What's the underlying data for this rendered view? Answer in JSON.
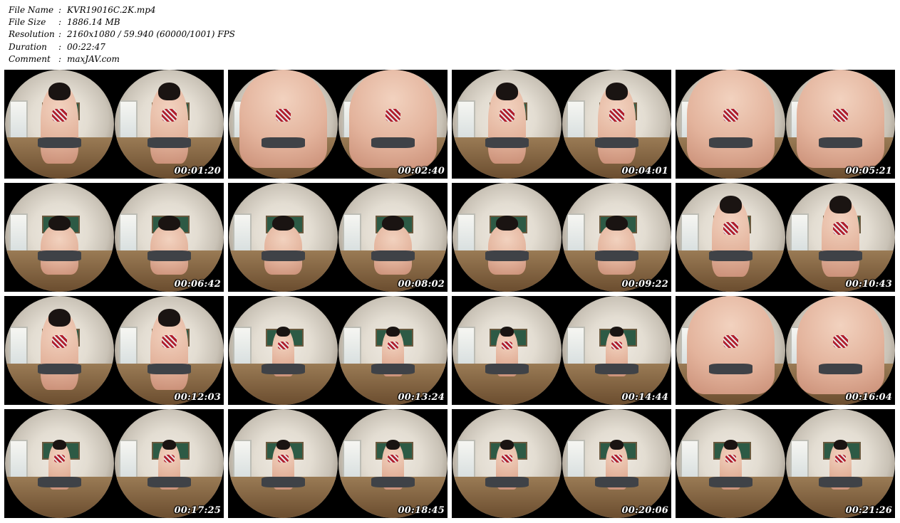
{
  "meta": {
    "rows": [
      {
        "label": "File Name",
        "sep": ":",
        "value": "KVR19016C.2K.mp4"
      },
      {
        "label": "File Size",
        "sep": ":",
        "value": "1886.14 MB"
      },
      {
        "label": "Resolution",
        "sep": ":",
        "value": "2160x1080 / 59.940 (60000/1001) FPS"
      },
      {
        "label": "Duration",
        "sep": ":",
        "value": "00:22:47"
      },
      {
        "label": "Comment",
        "sep": ":",
        "value": "maxJAV.com"
      }
    ]
  },
  "thumbnails": [
    {
      "time": "00:01:20",
      "view": "mid"
    },
    {
      "time": "00:02:40",
      "view": "close"
    },
    {
      "time": "00:04:01",
      "view": "mid"
    },
    {
      "time": "00:05:21",
      "view": "close"
    },
    {
      "time": "00:06:42",
      "view": "back"
    },
    {
      "time": "00:08:02",
      "view": "back"
    },
    {
      "time": "00:09:22",
      "view": "back"
    },
    {
      "time": "00:10:43",
      "view": "mid"
    },
    {
      "time": "00:12:03",
      "view": "mid"
    },
    {
      "time": "00:13:24",
      "view": "far"
    },
    {
      "time": "00:14:44",
      "view": "far"
    },
    {
      "time": "00:16:04",
      "view": "close"
    },
    {
      "time": "00:17:25",
      "view": "far"
    },
    {
      "time": "00:18:45",
      "view": "far"
    },
    {
      "time": "00:20:06",
      "view": "far"
    },
    {
      "time": "00:21:26",
      "view": "far"
    }
  ]
}
